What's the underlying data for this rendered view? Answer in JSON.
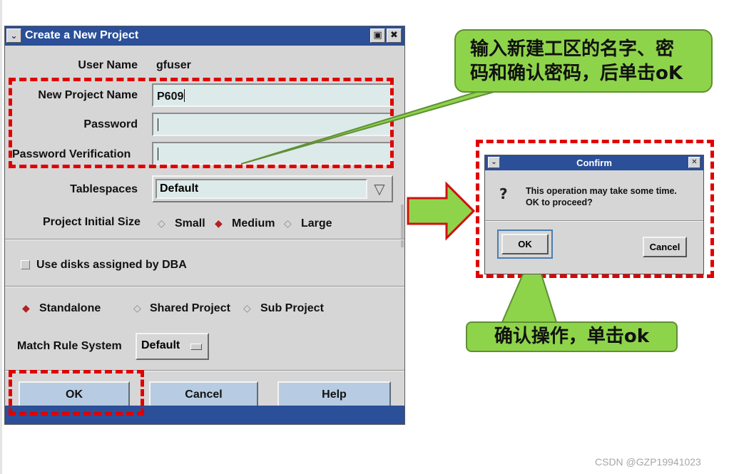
{
  "main_dialog": {
    "title": "Create a New Project",
    "title_buttons": {
      "menu_glyph": "⌄",
      "maximize_glyph": "▣",
      "close_glyph": "✖"
    },
    "user_name": {
      "label": "User Name",
      "value": "gfuser"
    },
    "project_name": {
      "label": "New Project Name",
      "value": "P609"
    },
    "password": {
      "label": "Password",
      "value": ""
    },
    "password_verification": {
      "label": "Password Verification",
      "value": ""
    },
    "tablespaces": {
      "label": "Tablespaces",
      "value": "Default",
      "arrow_glyph": "▽"
    },
    "initial_size": {
      "label": "Project Initial Size",
      "options": [
        {
          "label": "Small",
          "selected": false
        },
        {
          "label": "Medium",
          "selected": true
        },
        {
          "label": "Large",
          "selected": false
        }
      ]
    },
    "use_disks": {
      "label": "Use disks assigned by DBA",
      "checked": false
    },
    "project_type": {
      "options": [
        {
          "label": "Standalone",
          "selected": true
        },
        {
          "label": "Shared Project",
          "selected": false
        },
        {
          "label": "Sub Project",
          "selected": false
        }
      ]
    },
    "match_rule": {
      "label": "Match Rule System",
      "value": "Default"
    },
    "buttons": {
      "ok": "OK",
      "cancel": "Cancel",
      "help": "Help"
    }
  },
  "callout_top": {
    "line1": "输入新建工区的名字、密",
    "line2": "码和确认密码，后单击oK"
  },
  "confirm_dialog": {
    "title": "Confirm",
    "close_glyph": "✕",
    "menu_glyph": "⌄",
    "message_line1": "This operation may take some time.",
    "message_line2": "OK to proceed?",
    "icon_glyph": "?",
    "ok_label": "OK",
    "cancel_label": "Cancel"
  },
  "callout_bottom": {
    "text": "确认操作，单击ok"
  },
  "watermark": "CSDN @GZP19941023",
  "colors": {
    "titlebar": "#2b4f98",
    "dialog_bg": "#d6d6d6",
    "field_bg": "#dceaea",
    "button_bg": "#b7cce3",
    "highlight_red": "#e00000",
    "callout_green": "#8ed44a",
    "radio_selected": "#b22222"
  }
}
